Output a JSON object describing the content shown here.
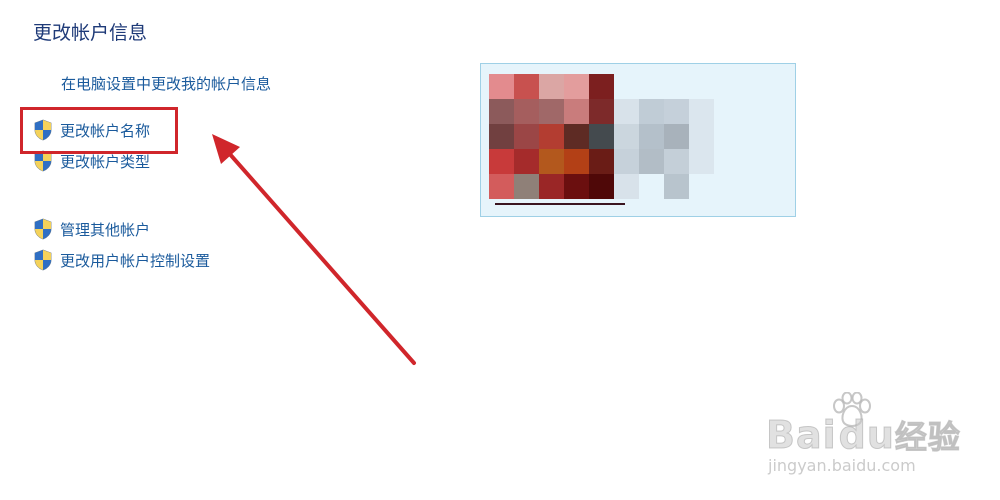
{
  "page": {
    "title": "更改帐户信息"
  },
  "links": {
    "pc_settings": "在电脑设置中更改我的帐户信息",
    "change_name": "更改帐户名称",
    "change_type": "更改帐户类型",
    "manage_other": "管理其他帐户",
    "uac_settings": "更改用户帐户控制设置"
  },
  "icons": {
    "shield": "uac-shield-icon"
  },
  "colors": {
    "title": "#1e3a78",
    "link": "#1a5a9c",
    "highlight": "#d0262b",
    "arrow": "#d0262b",
    "panel_bg": "#e6f4fb",
    "panel_border": "#9fd0e6"
  },
  "avatar": {
    "mosaic_colors": [
      [
        "#e38b8e",
        "#c8514f",
        "#dba6a4",
        "#e39d9d",
        "#7c1f1f",
        "",
        "",
        "",
        ""
      ],
      [
        "#8c5a5b",
        "#a55e5e",
        "#a06868",
        "#c97c7c",
        "#7d2a2a",
        "#d8e2ea",
        "#c0ccd6",
        "#c5d0da",
        "#dbe6ee"
      ],
      [
        "#714040",
        "#9b4646",
        "#b33d31",
        "#5e2b24",
        "#444a4e",
        "#cbd6de",
        "#b4c0ca",
        "#a8b2bb",
        "#dbe6ee"
      ],
      [
        "#c83a3a",
        "#a52b2b",
        "#b3581d",
        "#b34016",
        "#6a1c16",
        "#c6d1da",
        "#b2bdc6",
        "#c4cfd8",
        "#dbe6ee"
      ],
      [
        "#d35c5c",
        "#8f8078",
        "#9a2626",
        "#6b0f0f",
        "#4f0808",
        "#d8e2ea",
        "",
        "#b8c4cd",
        ""
      ]
    ]
  },
  "watermark": {
    "brand_prefix": "Bai",
    "brand_suffix": "du",
    "brand_cn": "经验",
    "url": "jingyan.baidu.com"
  }
}
